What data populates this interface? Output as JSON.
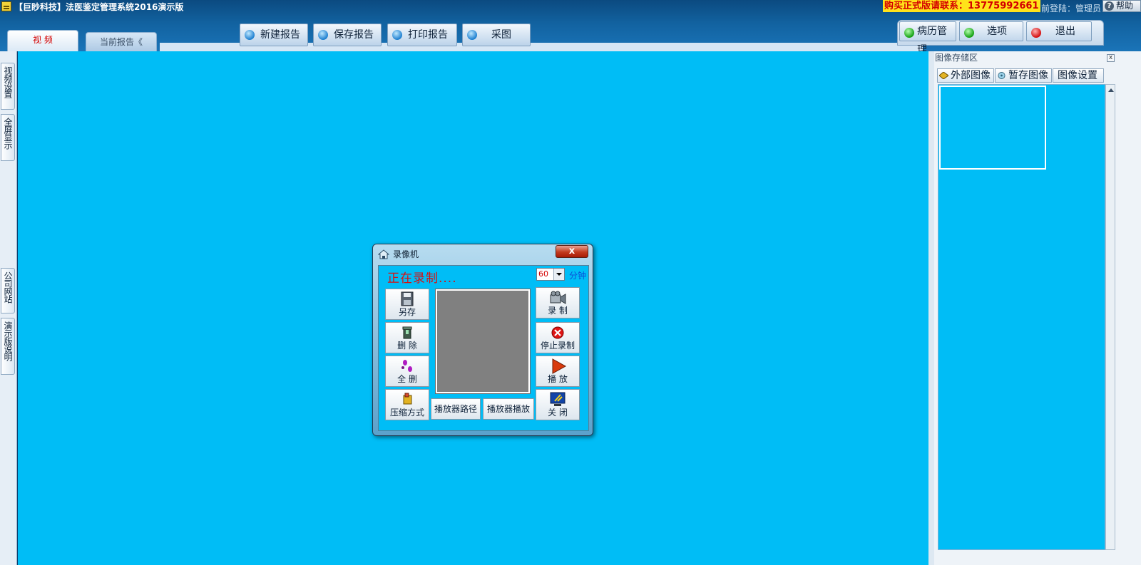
{
  "app": {
    "title": "【巨眇科技】法医鉴定管理系统2016演示版",
    "buy_banner": "购买正式版请联系：13775992661",
    "login_label": "当前登陆：管理员",
    "help": "帮助"
  },
  "tabs": [
    {
      "label": "视 频"
    },
    {
      "label": "当前报告《"
    }
  ],
  "toolbar": {
    "new_report": "新建报告",
    "save_report": "保存报告",
    "print_report": "打印报告",
    "capture": "采图"
  },
  "right_buttons": {
    "records": "病历管理",
    "options": "选项",
    "exit": "退出"
  },
  "left_tabs": [
    "视频设置",
    "全屏显示",
    "公司网站",
    "演示版说明"
  ],
  "image_panel": {
    "title": "图像存储区",
    "close": "x",
    "tabs": [
      "外部图像",
      "暂存图像",
      "图像设置"
    ]
  },
  "recorder": {
    "title": "录像机",
    "close": "x",
    "status": "正在录制....",
    "minutes": "60",
    "minutes_unit": "分钟",
    "buttons": {
      "save_as": "另存",
      "delete": "删 除",
      "delete_all": "全 删",
      "compression": "压缩方式",
      "record": "录 制",
      "stop": "停止录制",
      "play": "播 放",
      "close": "关 闭",
      "player_path": "播放器路径",
      "player_play": "播放器播放"
    }
  },
  "colors": {
    "video_bg": "#00bdf6",
    "banner_bg": "#ffe21a",
    "banner_text": "#d40000",
    "recording_text": "#d81010"
  }
}
